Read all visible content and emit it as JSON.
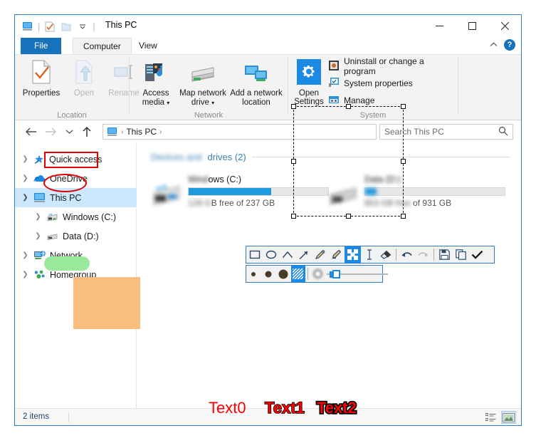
{
  "window": {
    "title": "This PC",
    "quick_access_toolbar": [
      "this-pc-icon",
      "properties-icon",
      "new-folder-icon",
      "customize-dropdown-icon"
    ],
    "controls": {
      "minimize": "─",
      "maximize": "☐",
      "close": "✕"
    }
  },
  "ribbon": {
    "tabs": [
      {
        "label": "File",
        "state": "file-menu"
      },
      {
        "label": "Computer",
        "state": "active"
      },
      {
        "label": "View",
        "state": "normal"
      }
    ],
    "collapse_icon": "chevron-up-icon",
    "help_icon": "help-icon",
    "help_label": "?",
    "groups": [
      {
        "label": "Location",
        "buttons": [
          {
            "label": "Properties",
            "icon": "properties-icon",
            "enabled": true
          },
          {
            "label": "Open",
            "icon": "open-icon",
            "enabled": false
          },
          {
            "label": "Rename",
            "icon": "rename-icon",
            "enabled": false
          }
        ]
      },
      {
        "label": "Network",
        "buttons": [
          {
            "label": "Access media",
            "icon": "media-server-icon",
            "enabled": true,
            "dropdown": true
          },
          {
            "label": "Map network drive",
            "icon": "map-drive-icon",
            "enabled": true,
            "dropdown": true
          },
          {
            "label": "Add a network location",
            "icon": "add-network-location-icon",
            "enabled": true,
            "dropdown": false
          }
        ]
      },
      {
        "label": "System",
        "buttons": [
          {
            "label": "Open Settings",
            "icon": "settings-gear-icon",
            "enabled": true
          }
        ],
        "small_buttons": [
          {
            "label": "Uninstall or change a program",
            "icon": "uninstall-icon"
          },
          {
            "label": "System properties",
            "icon": "system-properties-icon"
          },
          {
            "label": "Manage",
            "icon": "manage-icon"
          }
        ]
      }
    ]
  },
  "addressbar": {
    "back_icon": "arrow-left-icon",
    "forward_icon": "arrow-right-icon",
    "recent_icon": "chevron-down-icon",
    "up_icon": "arrow-up-icon",
    "breadcrumb": {
      "icon": "this-pc-icon",
      "items": [
        "This PC"
      ],
      "separator": "›"
    },
    "search": {
      "placeholder": "Search This PC",
      "icon": "search-icon"
    }
  },
  "navpane": {
    "items": [
      {
        "label": "Quick access",
        "icon": "quick-access-star-icon",
        "expander": "›",
        "level": 0,
        "selected": false
      },
      {
        "label": "OneDrive",
        "icon": "onedrive-cloud-icon",
        "expander": "›",
        "level": 0,
        "selected": false
      },
      {
        "label": "This PC",
        "icon": "this-pc-icon",
        "expander": "∨",
        "level": 0,
        "selected": true
      },
      {
        "label": "Windows (C:)",
        "icon": "system-drive-icon",
        "expander": "›",
        "level": 1,
        "selected": false
      },
      {
        "label": "Data (D:)",
        "icon": "hard-drive-icon",
        "expander": "›",
        "level": 1,
        "selected": false
      },
      {
        "label": "Network",
        "icon": "network-icon",
        "expander": "›",
        "level": 0,
        "selected": false
      },
      {
        "label": "Homegroup",
        "icon": "homegroup-icon",
        "expander": "›",
        "level": 0,
        "selected": false
      }
    ]
  },
  "content": {
    "group_header": "drives (2)",
    "group_header_obscured_prefix": "Devices and",
    "drives": [
      {
        "name": "ows (C:)",
        "name_obscured_prefix": "Wind",
        "free_text": "B free of 237 GB",
        "fill_percent": 59,
        "icon": "system-drive-icon"
      },
      {
        "name": "",
        "name_obscured": "Data (D:)",
        "free_text": "of 931 GB",
        "fill_percent": 8,
        "icon": "hard-drive-icon"
      }
    ]
  },
  "statusbar": {
    "item_count": "2 items",
    "view_buttons": [
      {
        "name": "details-view-button",
        "icon": "details-view-icon",
        "active": false
      },
      {
        "name": "large-icons-view-button",
        "icon": "large-icons-view-icon",
        "active": true
      }
    ]
  },
  "annotations": {
    "rect_highlight": {
      "target": "Quick access",
      "color": "#e00000",
      "shape": "rectangle"
    },
    "ellipse_highlight": {
      "target": "OneDrive",
      "color": "#e00000",
      "shape": "ellipse"
    },
    "green_highlight": {
      "target": "Network",
      "color": "#9ae89a"
    },
    "orange_highlight": {
      "color": "#f9bd7e"
    },
    "selection": {
      "label": "selection-rectangle",
      "handles": 8
    },
    "texts": [
      {
        "label": "Text0",
        "color": "#ff0000",
        "outline_width": 0
      },
      {
        "label": "Text1",
        "color": "#ff0000",
        "outline_width": 1
      },
      {
        "label": "Text2",
        "color": "#ff0000",
        "outline_width": 3
      }
    ]
  },
  "toolbar": {
    "row1": [
      {
        "name": "rectangle-tool",
        "icon": "rectangle-icon",
        "selected": false
      },
      {
        "name": "ellipse-tool",
        "icon": "ellipse-icon",
        "selected": false
      },
      {
        "name": "line-tool",
        "icon": "line-icon",
        "selected": false
      },
      {
        "name": "arrow-tool",
        "icon": "arrow-icon",
        "selected": false
      },
      {
        "name": "freehand-tool",
        "icon": "pencil-icon",
        "selected": false
      },
      {
        "name": "highlight-tool",
        "icon": "marker-icon",
        "selected": false
      },
      {
        "name": "obfuscate-tool",
        "icon": "pixelate-icon",
        "selected": true
      },
      {
        "name": "text-tool",
        "icon": "text-cursor-icon",
        "selected": false
      },
      {
        "name": "eraser-tool",
        "icon": "eraser-icon",
        "selected": false
      },
      {
        "name": "undo-button",
        "icon": "undo-arrow-icon",
        "selected": false
      },
      {
        "name": "redo-button",
        "icon": "redo-arrow-icon",
        "selected": false,
        "disabled": true
      },
      {
        "name": "save-button",
        "icon": "floppy-disk-icon",
        "selected": false
      },
      {
        "name": "copy-button",
        "icon": "copy-pages-icon",
        "selected": false
      },
      {
        "name": "confirm-button",
        "icon": "checkmark-icon",
        "selected": false
      }
    ],
    "row2": [
      {
        "name": "thickness-small",
        "icon": "dot-small-icon",
        "selected": false
      },
      {
        "name": "thickness-medium",
        "icon": "dot-medium-icon",
        "selected": false
      },
      {
        "name": "thickness-large",
        "icon": "dot-large-icon",
        "selected": false
      },
      {
        "name": "pixelate-mode",
        "icon": "hatch-pattern-icon",
        "selected": true
      },
      {
        "name": "blur-mode",
        "icon": "blur-circle-icon",
        "selected": false
      }
    ],
    "slider": {
      "name": "blur-strength-slider",
      "value_percent": 10
    }
  },
  "colors": {
    "accent_blue": "#1672ba",
    "selection_blue": "#cce8ff",
    "toolbar_blue": "#1a8ae5",
    "annotation_red": "#e00000",
    "highlight_green": "#9ae89a",
    "highlight_orange": "#f9bd7e"
  }
}
